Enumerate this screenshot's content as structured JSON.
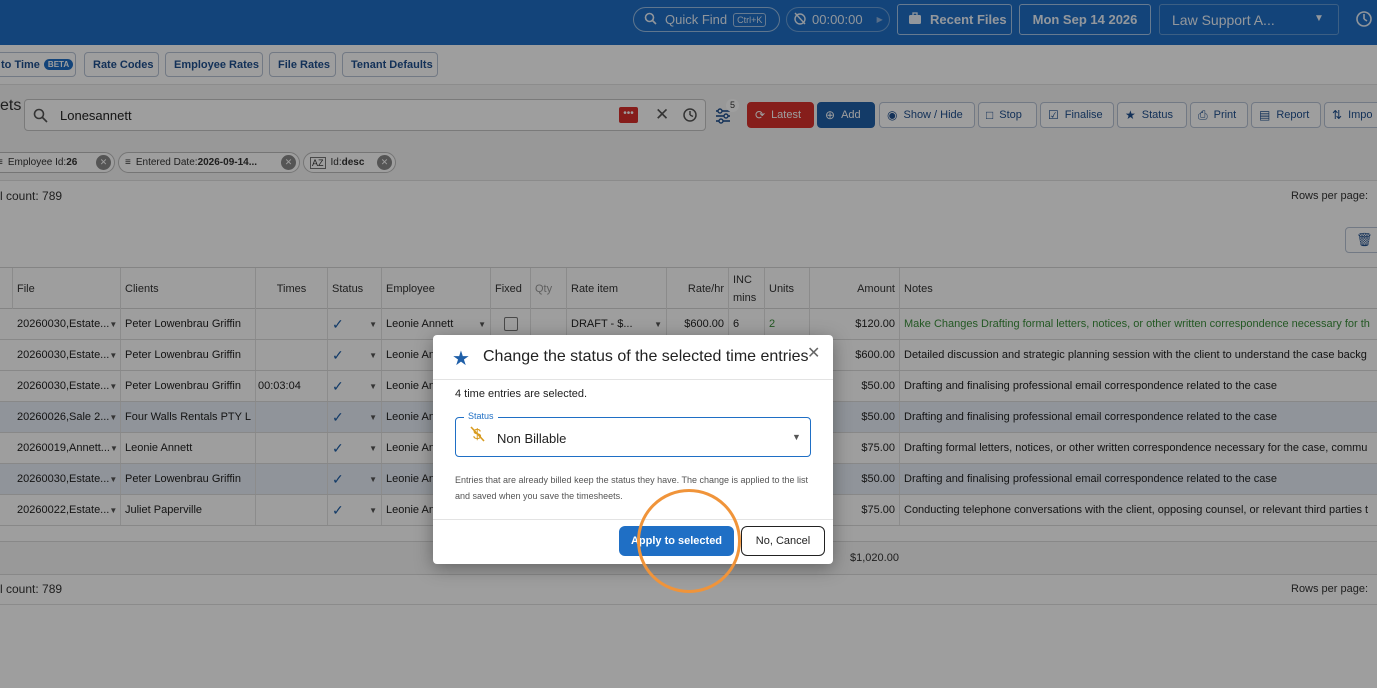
{
  "topbar": {
    "quick_find": "Quick Find",
    "quick_find_kbd": "Ctrl+K",
    "timer": "00:00:00",
    "recent_files": "Recent Files",
    "date": "Mon Sep 14 2026",
    "firm": "Law Support A...",
    "brand_color": "#1f6fc5"
  },
  "subbar": {
    "items": [
      {
        "label": "to Time",
        "badge": "BETA"
      },
      {
        "label": "Rate Codes"
      },
      {
        "label": "Employee Rates"
      },
      {
        "label": "File Rates"
      },
      {
        "label": "Tenant Defaults"
      }
    ]
  },
  "search": {
    "title_fragment": "ets",
    "value": "Lonesannett",
    "red_badge": "•••",
    "filter_count": "5"
  },
  "actions": {
    "latest": "Latest",
    "add": "Add",
    "show_hide": "Show / Hide",
    "stop": "Stop",
    "finalise": "Finalise",
    "status": "Status",
    "print": "Print",
    "report": "Report",
    "import": "Impo"
  },
  "chips": [
    {
      "label": "Employee Id:",
      "value": "26"
    },
    {
      "label": "Entered Date:",
      "value": "2026-09-14..."
    },
    {
      "label": "Id:",
      "value": "desc"
    }
  ],
  "count_top": "l count: 789",
  "count_bottom": "l count: 789",
  "rows_per_page": "Rows per page:",
  "table": {
    "headers": [
      "File",
      "Clients",
      "Times",
      "Status",
      "Employee",
      "Fixed",
      "Qty",
      "Rate item",
      "Rate/hr",
      "INC mins",
      "Units",
      "Amount",
      "Notes"
    ],
    "rows": [
      {
        "file": "20260030,Estate...",
        "client": "Peter Lowenbrau Griffin",
        "times": "",
        "employee": "Leonie Annett",
        "rate_item": "DRAFT - $...",
        "rate": "$600.00",
        "inc": "6",
        "units": "2",
        "amount": "$120.00",
        "notes": "Make Changes Drafting formal letters, notices, or other written correspondence necessary for th",
        "selected": false
      },
      {
        "file": "20260030,Estate...",
        "client": "Peter Lowenbrau Griffin",
        "times": "",
        "employee": "Leonie An",
        "rate_item": "",
        "rate": "",
        "inc": "",
        "units": "",
        "amount": "$600.00",
        "notes": "Detailed discussion and strategic planning session with the client to understand the case backg",
        "selected": false
      },
      {
        "file": "20260030,Estate...",
        "client": "Peter Lowenbrau Griffin",
        "times": "00:03:04",
        "employee": "Leonie An",
        "rate_item": "",
        "rate": "",
        "inc": "",
        "units": "",
        "amount": "$50.00",
        "notes": "Drafting and finalising professional email correspondence related to the case",
        "selected": false
      },
      {
        "file": "20260026,Sale 2...",
        "client": "Four Walls Rentals PTY L",
        "times": "",
        "employee": "Leonie An",
        "rate_item": "",
        "rate": "",
        "inc": "",
        "units": "",
        "amount": "$50.00",
        "notes": "Drafting and finalising professional email correspondence related to the case",
        "selected": true
      },
      {
        "file": "20260019,Annett...",
        "client": "Leonie Annett",
        "times": "",
        "employee": "Leonie An",
        "rate_item": "",
        "rate": "",
        "inc": "",
        "units": "",
        "amount": "$75.00",
        "notes": "Drafting formal letters, notices, or other written correspondence necessary for the case, commu",
        "selected": false
      },
      {
        "file": "20260030,Estate...",
        "client": "Peter Lowenbrau Griffin",
        "times": "",
        "employee": "Leonie An",
        "rate_item": "",
        "rate": "",
        "inc": "",
        "units": "",
        "amount": "$50.00",
        "notes": "Drafting and finalising professional email correspondence related to the case",
        "selected": true
      },
      {
        "file": "20260022,Estate...",
        "client": "Juliet Paperville",
        "times": "",
        "employee": "Leonie An",
        "rate_item": "",
        "rate": "",
        "inc": "",
        "units": "",
        "amount": "$75.00",
        "notes": "Conducting telephone conversations with the client, opposing counsel, or relevant third parties t",
        "selected": false
      }
    ],
    "total_amount": "$1,020.00"
  },
  "dialog": {
    "title": "Change the status of the selected time entries",
    "info": "4 time entries are selected.",
    "status_label": "Status",
    "status_value": "Non Billable",
    "help": "Entries that are already billed keep the status they have. The change is applied to the list and saved when you save the timesheets.",
    "apply": "Apply to selected",
    "cancel": "No, Cancel",
    "highlight_color": "#f0943a"
  }
}
